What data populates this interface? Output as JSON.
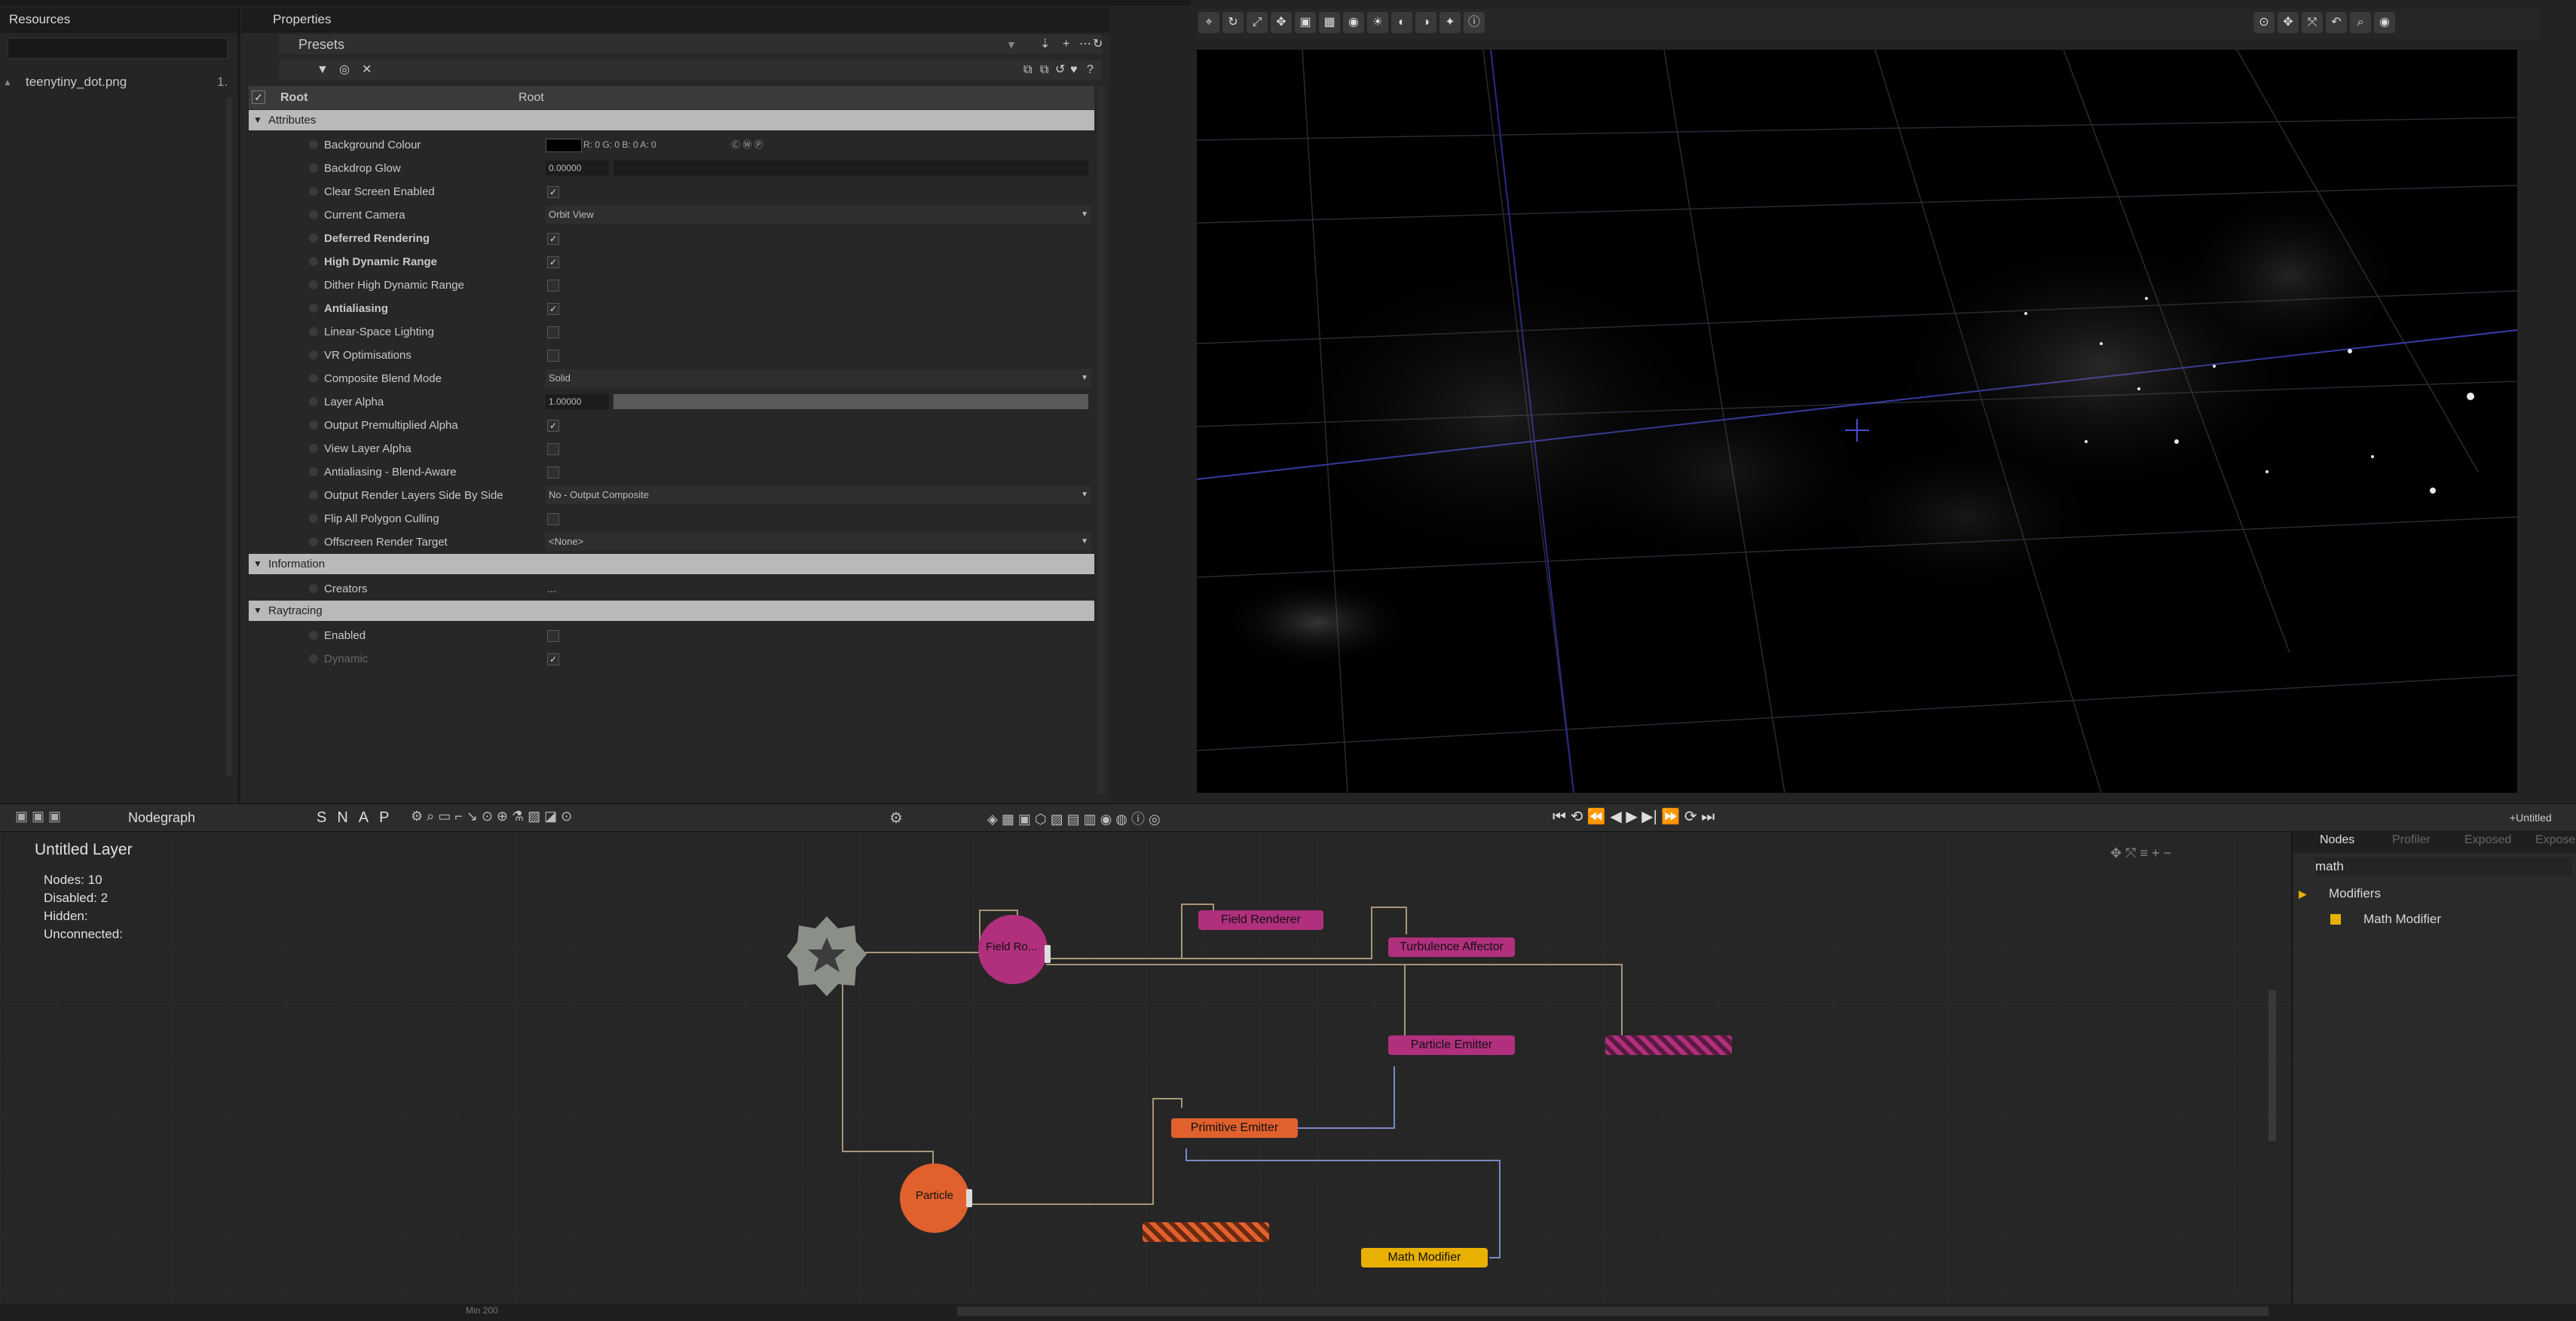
{
  "resources": {
    "title": "Resources",
    "file_name": "teenytiny_dot.png",
    "file_count": "1."
  },
  "properties": {
    "title": "Properties",
    "presets_label": "Presets",
    "root_label": "Root",
    "root_type": "Root",
    "sections": {
      "attributes": "Attributes",
      "information": "Information",
      "raytracing": "Raytracing"
    },
    "rows": [
      {
        "label": "Background Colour",
        "value": "R: 0 G: 0 B: 0 A: 0",
        "type": "color",
        "bold": false
      },
      {
        "label": "Backdrop Glow",
        "value": "0.00000",
        "type": "slider",
        "bold": false
      },
      {
        "label": "Clear Screen Enabled",
        "value": "",
        "type": "check",
        "checked": true,
        "bold": false
      },
      {
        "label": "Current Camera",
        "value": "Orbit View",
        "type": "dropdown",
        "bold": false
      },
      {
        "label": "Deferred Rendering",
        "value": "",
        "type": "check",
        "checked": true,
        "bold": true
      },
      {
        "label": "High Dynamic Range",
        "value": "",
        "type": "check",
        "checked": true,
        "bold": true
      },
      {
        "label": "Dither High Dynamic Range",
        "value": "",
        "type": "check",
        "checked": false,
        "bold": false
      },
      {
        "label": "Antialiasing",
        "value": "",
        "type": "check",
        "checked": true,
        "bold": true
      },
      {
        "label": "Linear-Space Lighting",
        "value": "",
        "type": "check",
        "checked": false,
        "bold": false
      },
      {
        "label": "VR Optimisations",
        "value": "",
        "type": "check",
        "checked": false,
        "bold": false
      },
      {
        "label": "Composite Blend Mode",
        "value": "Solid",
        "type": "dropdown",
        "bold": false
      },
      {
        "label": "Layer Alpha",
        "value": "1.00000",
        "type": "sliderfull",
        "bold": false
      },
      {
        "label": "Output Premultiplied Alpha",
        "value": "",
        "type": "check",
        "checked": true,
        "bold": false
      },
      {
        "label": "View Layer Alpha",
        "value": "",
        "type": "check",
        "checked": false,
        "bold": false
      },
      {
        "label": "Antialiasing - Blend-Aware",
        "value": "",
        "type": "check",
        "checked": false,
        "bold": false
      },
      {
        "label": "Output Render Layers Side By Side",
        "value": "No - Output Composite",
        "type": "dropdown",
        "bold": false
      },
      {
        "label": "Flip All Polygon Culling",
        "value": "",
        "type": "check",
        "checked": false,
        "bold": false
      },
      {
        "label": "Offscreen Render Target",
        "value": "<None>",
        "type": "dropdown",
        "bold": false
      }
    ],
    "info_rows": [
      {
        "label": "Creators",
        "value": "..."
      }
    ],
    "ray_rows": [
      {
        "label": "Enabled",
        "checked": false,
        "dim": false
      },
      {
        "label": "Dynamic",
        "checked": true,
        "dim": true
      }
    ]
  },
  "viewport": {
    "toolbar_icons": [
      "axis",
      "rotate",
      "scale",
      "move",
      "box",
      "grid",
      "snap",
      "light",
      "cam",
      "render",
      "fx",
      "info"
    ]
  },
  "nodegraph": {
    "tab_label": "Nodegraph",
    "snap_letters": [
      "S",
      "N",
      "A",
      "P"
    ],
    "layer_title": "Untitled Layer",
    "stats": [
      {
        "k": "Nodes:",
        "v": "10"
      },
      {
        "k": "Disabled:",
        "v": "2"
      },
      {
        "k": "Hidden:",
        "v": ""
      },
      {
        "k": "Unconnected:",
        "v": ""
      }
    ],
    "nodes": {
      "field_ro": "Field Ro...",
      "field_renderer": "Field Renderer",
      "turbulence_affector": "Turbulence Affector",
      "particle_emitter": "Particle Emitter",
      "disabled_node_a": "",
      "primitive_emitter": "Primitive Emitter",
      "particle": "Particle",
      "disabled_node_b": "",
      "math_modifier": "Math Modifier"
    },
    "colors": {
      "magenta": "#b0307e",
      "orange": "#e0612d",
      "yellow": "#e8b000",
      "root_grey": "#8a8f88"
    }
  },
  "nodes_panel": {
    "tabs": [
      "Nodes",
      "Profiler",
      "Exposed",
      "Exposed"
    ],
    "search_value": "math",
    "category": "Modifiers",
    "item": "Math Modifier",
    "layer_tab": "+Untitled Layer"
  },
  "status": {
    "text": "Min 200"
  }
}
